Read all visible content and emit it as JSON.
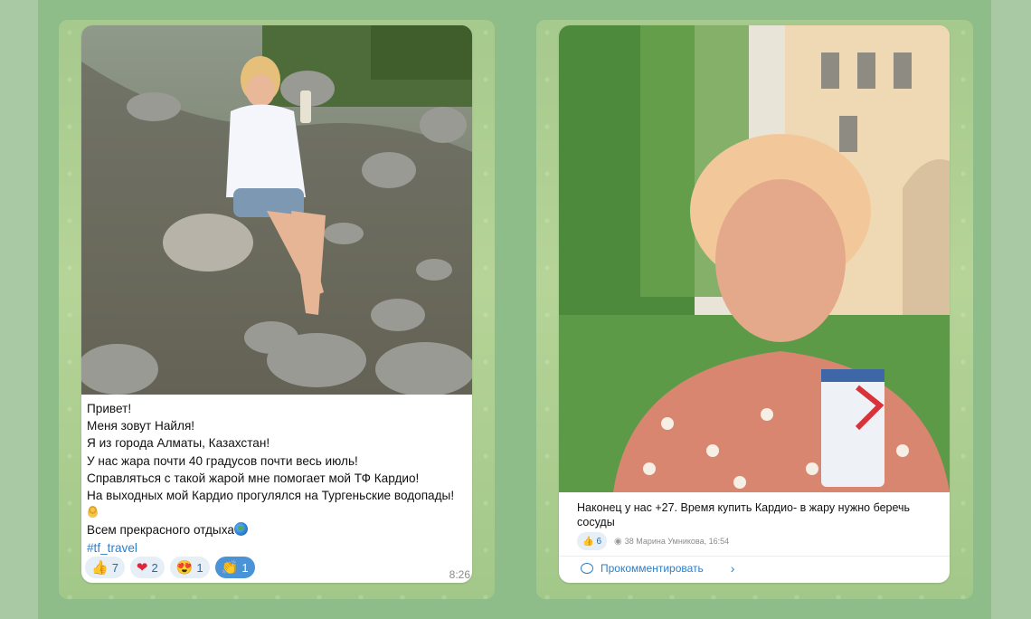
{
  "left_post": {
    "caption_lines": [
      "Привет!",
      "Меня зовут Найля!",
      "Я из города Алматы, Казахстан!",
      "У нас жара почти 40 градусов почти весь июль!",
      "Справляться с такой жарой мне помогает мой ТФ Кардио!",
      "На выходных мой Кардио прогулялся на Тургеньские водопады!"
    ],
    "closing_line": "Всем прекрасного отдыха",
    "hashtag": "#tf_travel",
    "reactions": [
      {
        "icon": "👍",
        "count": "7"
      },
      {
        "icon": "❤",
        "count": "2"
      },
      {
        "icon": "😍",
        "count": "1"
      },
      {
        "icon": "👏",
        "count": "1"
      }
    ],
    "time": "8:26"
  },
  "right_post": {
    "caption": "Наконец у нас +27. Время купить Кардио- в жару нужно беречь сосуды",
    "reaction": {
      "icon": "👍",
      "count": "6"
    },
    "views_meta": "38 Марина Умникова, 16:54",
    "comment_label": "Прокомментировать"
  }
}
